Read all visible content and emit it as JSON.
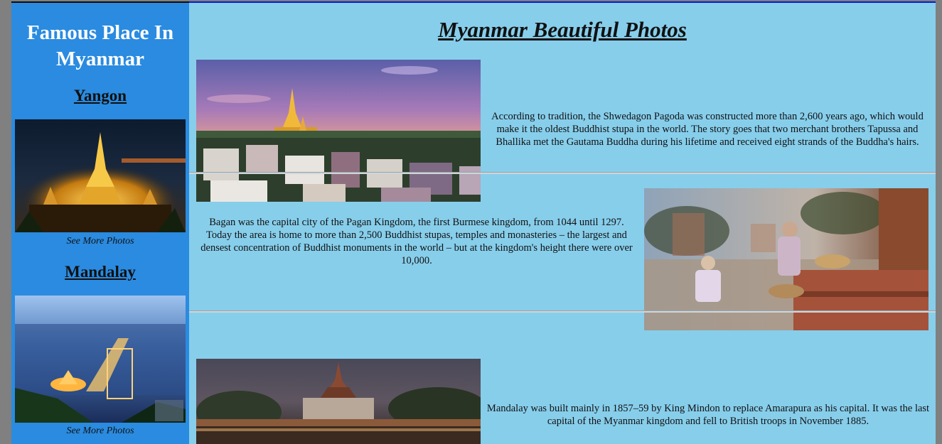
{
  "sidebar": {
    "title": "Famous Place In Myanmar",
    "sections": [
      {
        "city": "Yangon",
        "link": "See More Photos"
      },
      {
        "city": "Mandalay",
        "link": "See More Photos"
      }
    ]
  },
  "main": {
    "title": "Myanmar Beautiful Photos",
    "entries": [
      {
        "text": "According to tradition, the Shwedagon Pagoda was constructed more than 2,600 years ago, which would make it the oldest Buddhist stupa in the world. The story goes that two merchant brothers Tapussa and Bhallika met the Gautama Buddha during his lifetime and received eight strands of the Buddha's hairs."
      },
      {
        "text": "Bagan was the capital city of the Pagan Kingdom, the first Burmese kingdom, from 1044 until 1297. Today the area is home to more than 2,500 Buddhist stupas, temples and monasteries – the largest and densest concentration of Buddhist monuments in the world – but at the kingdom's height there were over 10,000."
      },
      {
        "text": "Mandalay was built mainly in 1857–59 by King Mindon to replace Amarapura as his capital. It was the last capital of the Myanmar kingdom and fell to British troops in November 1885."
      }
    ]
  },
  "colors": {
    "sidebar_bg": "#2a8be0",
    "main_bg": "#87ceeb",
    "page_bg": "#808080"
  }
}
